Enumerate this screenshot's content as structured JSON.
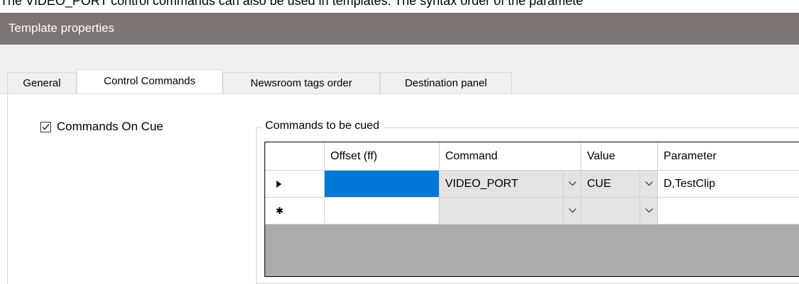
{
  "doc_text": "The VIDEO_PORT control commands can also be used in templates. The syntax order of the paramete",
  "window": {
    "title": "Template properties"
  },
  "tabs": [
    {
      "label": "General",
      "active": false
    },
    {
      "label": "Control Commands",
      "active": true
    },
    {
      "label": "Newsroom tags order",
      "active": false
    },
    {
      "label": "Destination panel",
      "active": false
    }
  ],
  "options": {
    "commands_on_cue_label": "Commands On Cue",
    "commands_on_cue_checked": true
  },
  "group": {
    "title": "Commands to be cued"
  },
  "grid": {
    "columns": [
      "Offset (ff)",
      "Command",
      "Value",
      "Parameter"
    ],
    "rows": [
      {
        "marker": "current-row",
        "offset": "",
        "command": "VIDEO_PORT",
        "value": "CUE",
        "parameter": "D,TestClip"
      },
      {
        "marker": "new-row",
        "offset": "",
        "command": "",
        "value": "",
        "parameter": ""
      }
    ]
  },
  "colors": {
    "titlebar": "#7d7473",
    "selection": "#0078d7",
    "grid_empty_area": "#ababab"
  },
  "icons": {
    "dropdown": "chevron-down-icon",
    "check": "checkmark-icon",
    "new_row": "asterisk-icon",
    "current_row": "row-pointer-icon"
  }
}
